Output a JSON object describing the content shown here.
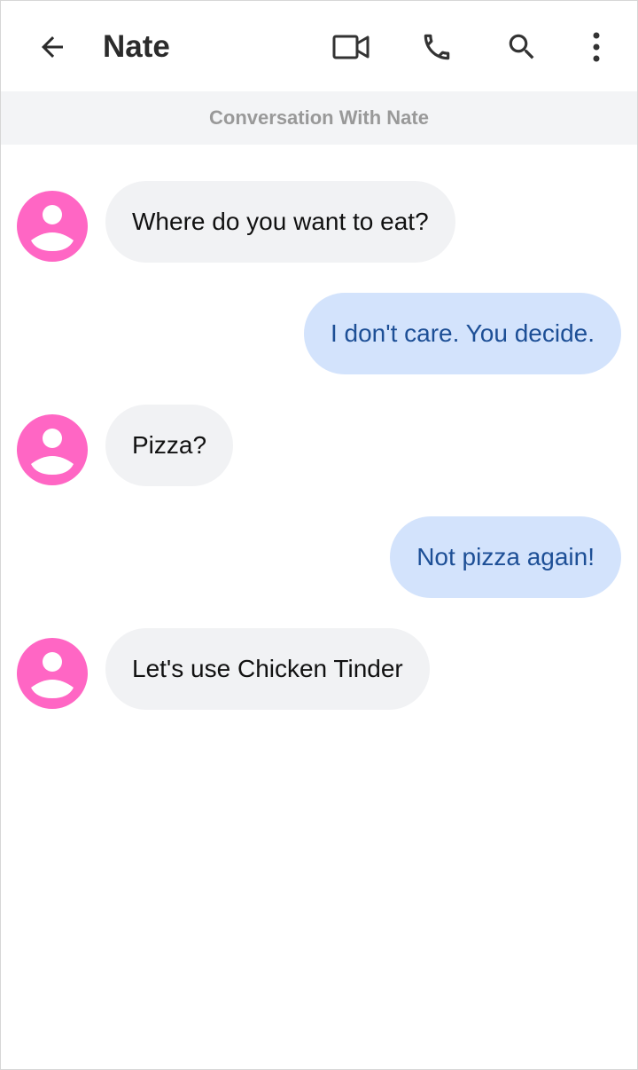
{
  "header": {
    "title": "Nate",
    "icons": [
      "back-arrow-icon",
      "video-camera-icon",
      "phone-icon",
      "search-icon",
      "more-vert-icon"
    ]
  },
  "subheader": {
    "text": "Conversation With Nate"
  },
  "messages": [
    {
      "from": "Nate",
      "text": "Where do you want to eat?"
    },
    {
      "from": "me",
      "text": "I don't care. You decide."
    },
    {
      "from": "Nate",
      "text": "Pizza?"
    },
    {
      "from": "me",
      "text": "Not pizza again!"
    },
    {
      "from": "Nate",
      "text": "Let's use Chicken Tinder"
    }
  ],
  "colors": {
    "avatar": "#ff66c4",
    "incoming_bubble": "#f1f2f4",
    "outgoing_bubble": "#d3e3fc",
    "outgoing_text": "#1d4f96",
    "subheader_bg": "#f3f4f6",
    "subheader_text": "#999999"
  }
}
